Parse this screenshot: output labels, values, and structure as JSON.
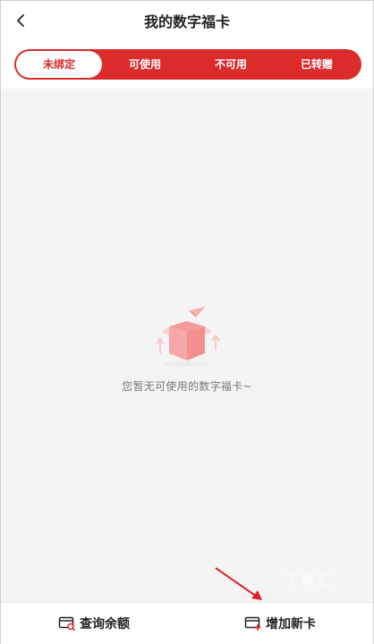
{
  "header": {
    "title": "我的数字福卡"
  },
  "tabs": [
    {
      "label": "未绑定",
      "active": true
    },
    {
      "label": "可使用",
      "active": false
    },
    {
      "label": "不可用",
      "active": false
    },
    {
      "label": "已转赠",
      "active": false
    }
  ],
  "empty_state": {
    "message": "您暂无可使用的数字福卡~"
  },
  "watermark": {
    "text": "下载汇"
  },
  "bottom_bar": {
    "balance_label": "查询余额",
    "add_card_label": "增加新卡"
  },
  "colors": {
    "accent": "#dc2b2b",
    "background": "#f4f4f4"
  },
  "icons": {
    "back": "chevron-left-icon",
    "empty": "open-box-icon",
    "balance": "card-search-icon",
    "add_card": "card-plus-icon"
  }
}
